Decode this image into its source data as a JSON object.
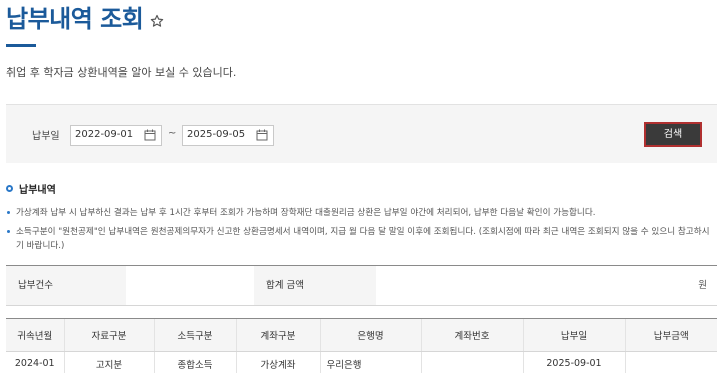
{
  "header": {
    "title": "납부내역 조회",
    "description": "취업 후 학자금 상환내역을 알아 보실 수 있습니다."
  },
  "search": {
    "date_label": "납부일",
    "start_date": "2022-09-01",
    "end_date": "2025-09-05",
    "separator": "~",
    "button_label": "검색"
  },
  "section": {
    "title": "납부내역",
    "notes": [
      "가상계좌 납부 시 납부하신 결과는 납부 후 1시간 후부터 조회가 가능하며 장학재단 대출원리금 상환은 납부일 야간에 처리되어, 납부한 다음날 확인이 가능합니다.",
      "소득구분이 \"원천공제\"인 납부내역은 원천공제의무자가 신고한 상환금명세서 내역이며, 지급 월 다음 달 말일 이후에 조회됩니다. (조회시점에 따라 최근 내역은 조회되지 않을 수 있으니 참고하시기 바랍니다.)"
    ]
  },
  "summary": {
    "count_label": "납부건수",
    "count_value": "",
    "total_label": "합계 금액",
    "total_value": "",
    "unit": "원"
  },
  "table": {
    "headers": [
      "귀속년월",
      "자료구분",
      "소득구분",
      "계좌구분",
      "은행명",
      "계좌번호",
      "납부일",
      "납부금액"
    ],
    "rows": [
      [
        "2024-01",
        "고지분",
        "종합소득",
        "가상계좌",
        "우리은행",
        "",
        "2025-09-01",
        ""
      ]
    ]
  },
  "colors": {
    "title_blue": "#1b5a9a",
    "bullet_blue": "#2a78c8",
    "button_bg": "#3a3a3a",
    "button_border": "#b03030"
  },
  "icons": {
    "favorite": "star-outline-icon",
    "calendar": "calendar-icon"
  }
}
